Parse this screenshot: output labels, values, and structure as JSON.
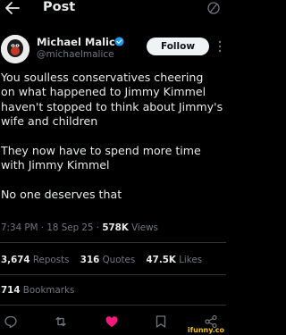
{
  "header": {
    "title": "Post",
    "back_icon": "arrow-left-icon",
    "grok_icon": "grok-slash-icon"
  },
  "author": {
    "name": "Michael Malice",
    "handle": "@michaelmalice",
    "verified_color": "#1d9bf0",
    "follow_label": "Follow"
  },
  "tweet": {
    "paragraphs": [
      [
        "You soulless conservatives cheering",
        "on what happened to Jimmy Kimmel",
        "haven't stopped to think about Jimmy's",
        "wife and children"
      ],
      [
        "They now have to spend more time",
        "with Jimmy Kimmel"
      ],
      [
        "No one deserves that"
      ]
    ]
  },
  "meta": {
    "time": "7:34 PM",
    "date": "18 Sep 25",
    "views_count": "578K",
    "views_label": "Views"
  },
  "stats": {
    "reposts_count": "3,674",
    "reposts_label": "Reposts",
    "quotes_count": "316",
    "quotes_label": "Quotes",
    "likes_count": "47.5K",
    "likes_label": "Likes",
    "bookmarks_count": "714",
    "bookmarks_label": "Bookmarks"
  },
  "actions": [
    "reply-icon",
    "repost-icon",
    "like-icon",
    "bookmark-icon",
    "share-icon"
  ],
  "colors": {
    "like": "#f91880",
    "muted": "#71767b",
    "text": "#e7e9ea"
  },
  "watermark": "ifunny.co"
}
